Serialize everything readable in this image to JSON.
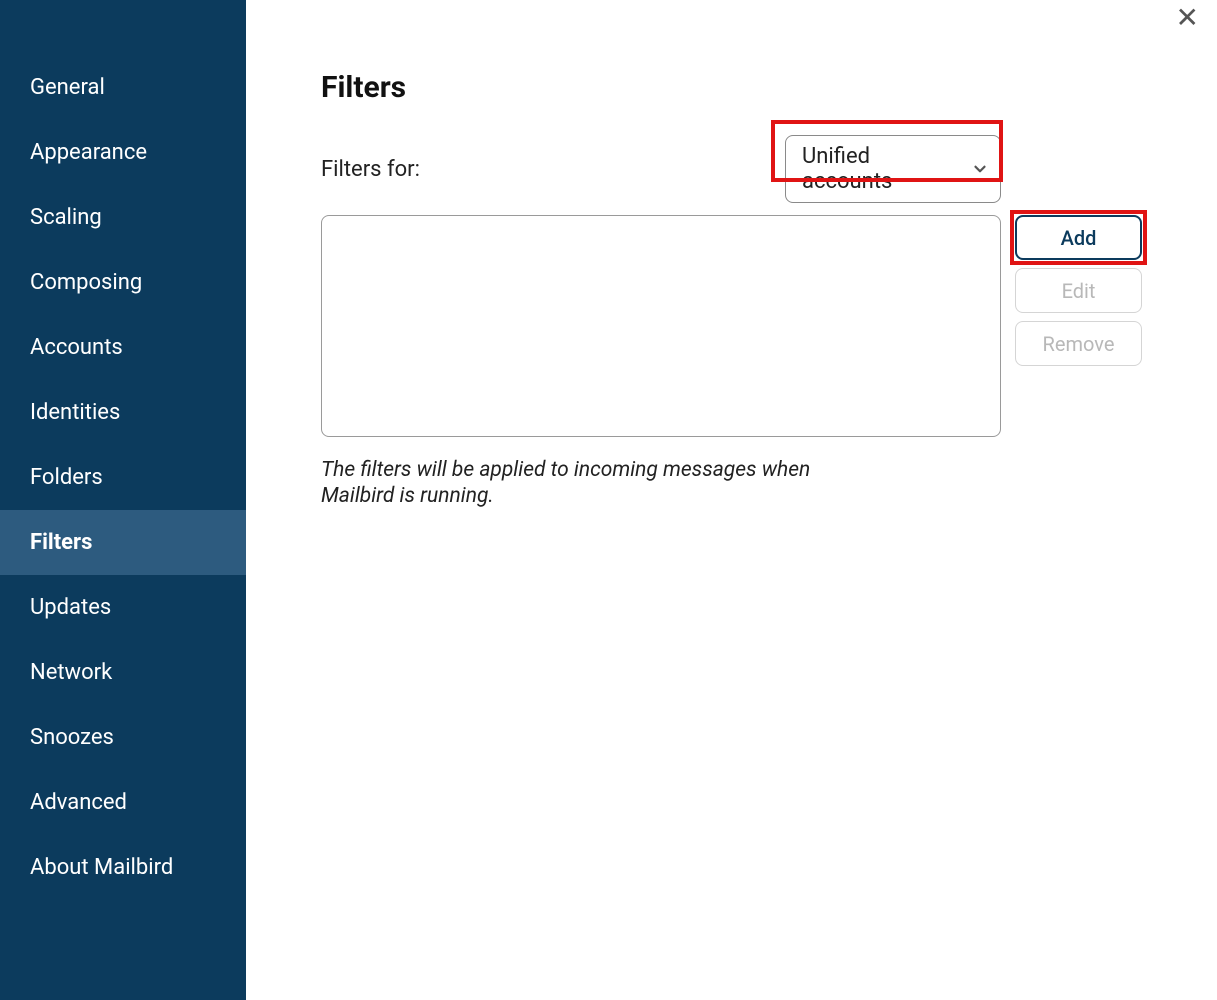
{
  "sidebar": {
    "items": [
      {
        "label": "General"
      },
      {
        "label": "Appearance"
      },
      {
        "label": "Scaling"
      },
      {
        "label": "Composing"
      },
      {
        "label": "Accounts"
      },
      {
        "label": "Identities"
      },
      {
        "label": "Folders"
      },
      {
        "label": "Filters"
      },
      {
        "label": "Updates"
      },
      {
        "label": "Network"
      },
      {
        "label": "Snoozes"
      },
      {
        "label": "Advanced"
      },
      {
        "label": "About Mailbird"
      }
    ],
    "active_index": 7
  },
  "page": {
    "title": "Filters",
    "filters_for_label": "Filters for:",
    "dropdown_value": "Unified accounts",
    "buttons": {
      "add": "Add",
      "edit": "Edit",
      "remove": "Remove"
    },
    "hint": "The filters will be applied to incoming messages when Mailbird is running."
  },
  "close_glyph": "✕"
}
